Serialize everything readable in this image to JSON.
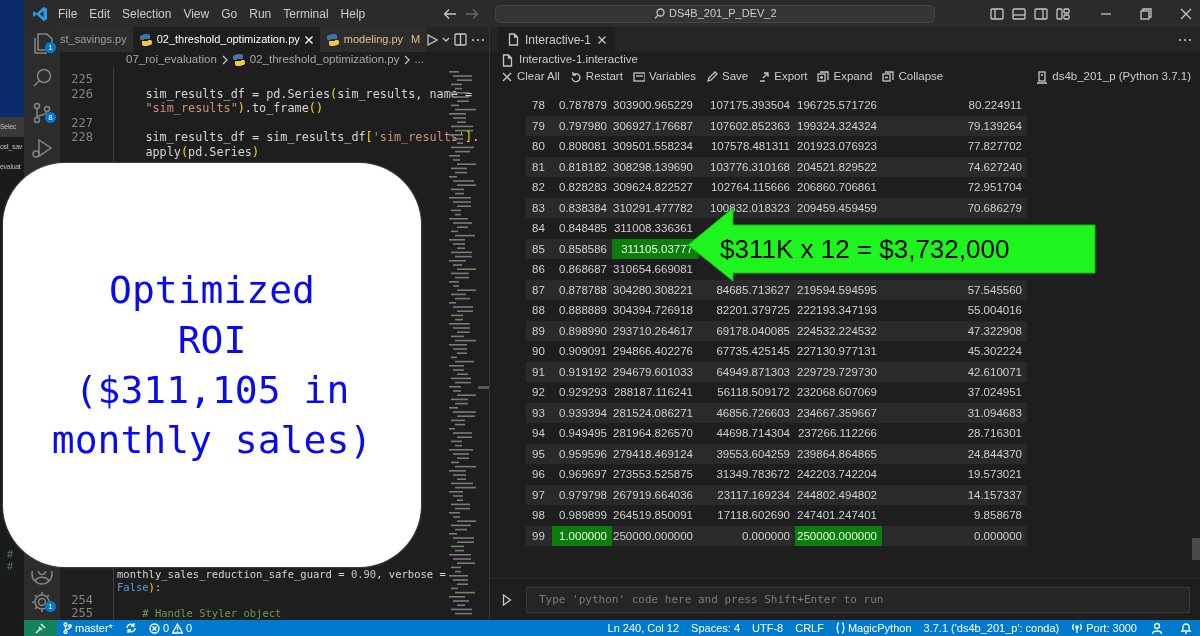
{
  "title_bar": {
    "menus": [
      "File",
      "Edit",
      "Selection",
      "View",
      "Go",
      "Run",
      "Terminal",
      "Help"
    ],
    "search": "DS4B_201_P_DEV_2"
  },
  "background_window": {
    "texts": [
      "Selec",
      "ost_sav",
      "evaluat"
    ],
    "marks": [
      "#",
      "#"
    ]
  },
  "activity_bar": [
    {
      "kind": "explorer",
      "badge": "1"
    },
    {
      "kind": "search"
    },
    {
      "kind": "source-control",
      "badge": "8"
    },
    {
      "kind": "run"
    },
    {
      "kind": "account"
    },
    {
      "kind": "settings",
      "badge": "1"
    }
  ],
  "editor": {
    "tabs": [
      {
        "label": "st_savings.py",
        "kind": "partial",
        "selected": false
      },
      {
        "label": "02_threshold_optimization.py",
        "kind": "file",
        "selected": true
      },
      {
        "label": "modeling.py",
        "kind": "file",
        "selected": false,
        "status": "M"
      }
    ],
    "breadcrumb": [
      {
        "label": "07_roi_evaluation",
        "kind": "folder"
      },
      {
        "label": "02_threshold_optimization.py",
        "kind": "file"
      },
      {
        "label": "...",
        "kind": "more"
      }
    ],
    "code_top": [
      {
        "number": "225"
      },
      {
        "number": "226",
        "segments": [
          {
            "kind": "plain",
            "text": "    sim_results_df = pd.Series"
          },
          {
            "kind": "paren",
            "text": "("
          },
          {
            "kind": "plain",
            "text": "sim_results, name ="
          }
        ]
      },
      {
        "segments": [
          {
            "kind": "string",
            "text": "    \"sim_results\""
          },
          {
            "kind": "paren",
            "text": ")"
          },
          {
            "kind": "plain",
            "text": ".to_frame"
          },
          {
            "kind": "paren",
            "text": "()"
          }
        ]
      },
      {
        "number": "227"
      },
      {
        "number": "228",
        "segments": [
          {
            "kind": "plain",
            "text": "    sim_results_df = sim_results_df"
          },
          {
            "kind": "paren",
            "text": "["
          },
          {
            "kind": "string",
            "text": "'sim_results'"
          },
          {
            "kind": "paren",
            "text": "]"
          },
          {
            "kind": "plain",
            "text": "."
          }
        ]
      },
      {
        "segments": [
          {
            "kind": "plain",
            "text": "    apply"
          },
          {
            "kind": "paren",
            "text": "("
          },
          {
            "kind": "plain",
            "text": "pd.Series"
          },
          {
            "kind": "paren",
            "text": ")"
          }
        ]
      }
    ],
    "code_bottom": [
      {
        "segments": [
          {
            "kind": "plain",
            "text": "monthly_sales_reduction_safe_guard = "
          },
          {
            "kind": "number",
            "text": "0.90"
          },
          {
            "kind": "plain",
            "text": ", verbose ="
          }
        ]
      },
      {
        "segments": [
          {
            "kind": "keyword",
            "text": "False"
          },
          {
            "kind": "paren",
            "text": ")"
          },
          {
            "kind": "plain",
            "text": ":"
          }
        ]
      },
      {
        "number": "254"
      },
      {
        "number": "255",
        "segments": [
          {
            "kind": "comment",
            "text": "    # Handle Styler object"
          }
        ]
      }
    ]
  },
  "panel": {
    "tab": {
      "label": "Interactive-1",
      "selected": true
    },
    "file": "Interactive-1.interactive",
    "toolbar": [
      {
        "kind": "clear",
        "label": "Clear All"
      },
      {
        "kind": "restart",
        "label": "Restart"
      },
      {
        "kind": "variables",
        "label": "Variables"
      },
      {
        "kind": "save",
        "label": "Save"
      },
      {
        "kind": "export",
        "label": "Export"
      },
      {
        "kind": "expand",
        "label": "Expand"
      },
      {
        "kind": "collapse",
        "label": "Collapse"
      }
    ],
    "kernel": "ds4b_201_p (Python 3.7.1)",
    "table": {
      "rows": [
        {
          "index": "78",
          "cells": [
            "0.787879",
            "303900.965229",
            "107175.393504",
            "196725.571726",
            "80.224911"
          ],
          "highlighted": [
            false,
            false,
            false,
            false,
            false
          ]
        },
        {
          "index": "79",
          "cells": [
            "0.797980",
            "306927.176687",
            "107602.852363",
            "199324.324324",
            "79.139264"
          ],
          "highlighted": [
            false,
            false,
            false,
            false,
            false
          ]
        },
        {
          "index": "80",
          "cells": [
            "0.808081",
            "309501.558234",
            "107578.481311",
            "201923.076923",
            "77.827702"
          ],
          "highlighted": [
            false,
            false,
            false,
            false,
            false
          ]
        },
        {
          "index": "81",
          "cells": [
            "0.818182",
            "308298.139690",
            "103776.310168",
            "204521.829522",
            "74.627240"
          ],
          "highlighted": [
            false,
            false,
            false,
            false,
            false
          ]
        },
        {
          "index": "82",
          "cells": [
            "0.828283",
            "309624.822527",
            "102764.115666",
            "206860.706861",
            "72.951704"
          ],
          "highlighted": [
            false,
            false,
            false,
            false,
            false
          ]
        },
        {
          "index": "83",
          "cells": [
            "0.838384",
            "310291.477782",
            "100832.018323",
            "209459.459459",
            "70.686279"
          ],
          "highlighted": [
            false,
            false,
            false,
            false,
            false
          ]
        },
        {
          "index": "84",
          "cells": [
            "0.848485",
            "311008.336361"
          ],
          "highlighted": [
            false,
            false
          ]
        },
        {
          "index": "85",
          "cells": [
            "0.858586",
            "311105.03777"
          ],
          "highlighted": [
            false,
            true
          ]
        },
        {
          "index": "86",
          "cells": [
            "0.868687",
            "310654.669081"
          ],
          "highlighted": [
            false,
            false
          ]
        },
        {
          "index": "87",
          "cells": [
            "0.878788",
            "304280.308221",
            "84685.713627",
            "219594.594595",
            "57.545560"
          ],
          "highlighted": [
            false,
            false,
            false,
            false,
            false
          ]
        },
        {
          "index": "88",
          "cells": [
            "0.888889",
            "304394.726918",
            "82201.379725",
            "222193.347193",
            "55.004016"
          ],
          "highlighted": [
            false,
            false,
            false,
            false,
            false
          ]
        },
        {
          "index": "89",
          "cells": [
            "0.898990",
            "293710.264617",
            "69178.040085",
            "224532.224532",
            "47.322908"
          ],
          "highlighted": [
            false,
            false,
            false,
            false,
            false
          ]
        },
        {
          "index": "90",
          "cells": [
            "0.909091",
            "294866.402276",
            "67735.425145",
            "227130.977131",
            "45.302224"
          ],
          "highlighted": [
            false,
            false,
            false,
            false,
            false
          ]
        },
        {
          "index": "91",
          "cells": [
            "0.919192",
            "294679.601033",
            "64949.871303",
            "229729.729730",
            "42.610071"
          ],
          "highlighted": [
            false,
            false,
            false,
            false,
            false
          ]
        },
        {
          "index": "92",
          "cells": [
            "0.929293",
            "288187.116241",
            "56118.509172",
            "232068.607069",
            "37.024951"
          ],
          "highlighted": [
            false,
            false,
            false,
            false,
            false
          ]
        },
        {
          "index": "93",
          "cells": [
            "0.939394",
            "281524.086271",
            "46856.726603",
            "234667.359667",
            "31.094683"
          ],
          "highlighted": [
            false,
            false,
            false,
            false,
            false
          ]
        },
        {
          "index": "94",
          "cells": [
            "0.949495",
            "281964.826570",
            "44698.714304",
            "237266.112266",
            "28.716301"
          ],
          "highlighted": [
            false,
            false,
            false,
            false,
            false
          ]
        },
        {
          "index": "95",
          "cells": [
            "0.959596",
            "279418.469124",
            "39553.604259",
            "239864.864865",
            "24.844370"
          ],
          "highlighted": [
            false,
            false,
            false,
            false,
            false
          ]
        },
        {
          "index": "96",
          "cells": [
            "0.969697",
            "273553.525875",
            "31349.783672",
            "242203.742204",
            "19.573021"
          ],
          "highlighted": [
            false,
            false,
            false,
            false,
            false
          ]
        },
        {
          "index": "97",
          "cells": [
            "0.979798",
            "267919.664036",
            "23117.169234",
            "244802.494802",
            "14.157337"
          ],
          "highlighted": [
            false,
            false,
            false,
            false,
            false
          ]
        },
        {
          "index": "98",
          "cells": [
            "0.989899",
            "264519.850091",
            "17118.602690",
            "247401.247401",
            "9.858678"
          ],
          "highlighted": [
            false,
            false,
            false,
            false,
            false
          ]
        },
        {
          "index": "99",
          "cells": [
            "1.000000",
            "250000.000000",
            "0.000000",
            "250000.000000",
            "0.000000"
          ],
          "highlighted": [
            true,
            false,
            false,
            true,
            false
          ]
        }
      ]
    },
    "input": {
      "placeholder": "Type 'python' code here and press Shift+Enter to run"
    }
  },
  "overlay": {
    "caption_lines": [
      "Optimized",
      "ROI",
      "($311,105 in",
      "monthly sales)"
    ]
  },
  "callout": {
    "text": "$311K x 12 = $3,732,000"
  },
  "status_bar": {
    "branch": "master*",
    "errors": "0",
    "warnings": "0",
    "right": [
      {
        "kind": "text",
        "label": "Ln 240, Col 12"
      },
      {
        "kind": "text",
        "label": "Spaces: 4"
      },
      {
        "kind": "text",
        "label": "UTF-8"
      },
      {
        "kind": "text",
        "label": "CRLF"
      },
      {
        "kind": "language",
        "label": "MagicPython"
      },
      {
        "kind": "text",
        "label": "3.7.1 ('ds4b_201_p': conda)"
      },
      {
        "kind": "port",
        "label": "Port: 3000"
      }
    ]
  }
}
